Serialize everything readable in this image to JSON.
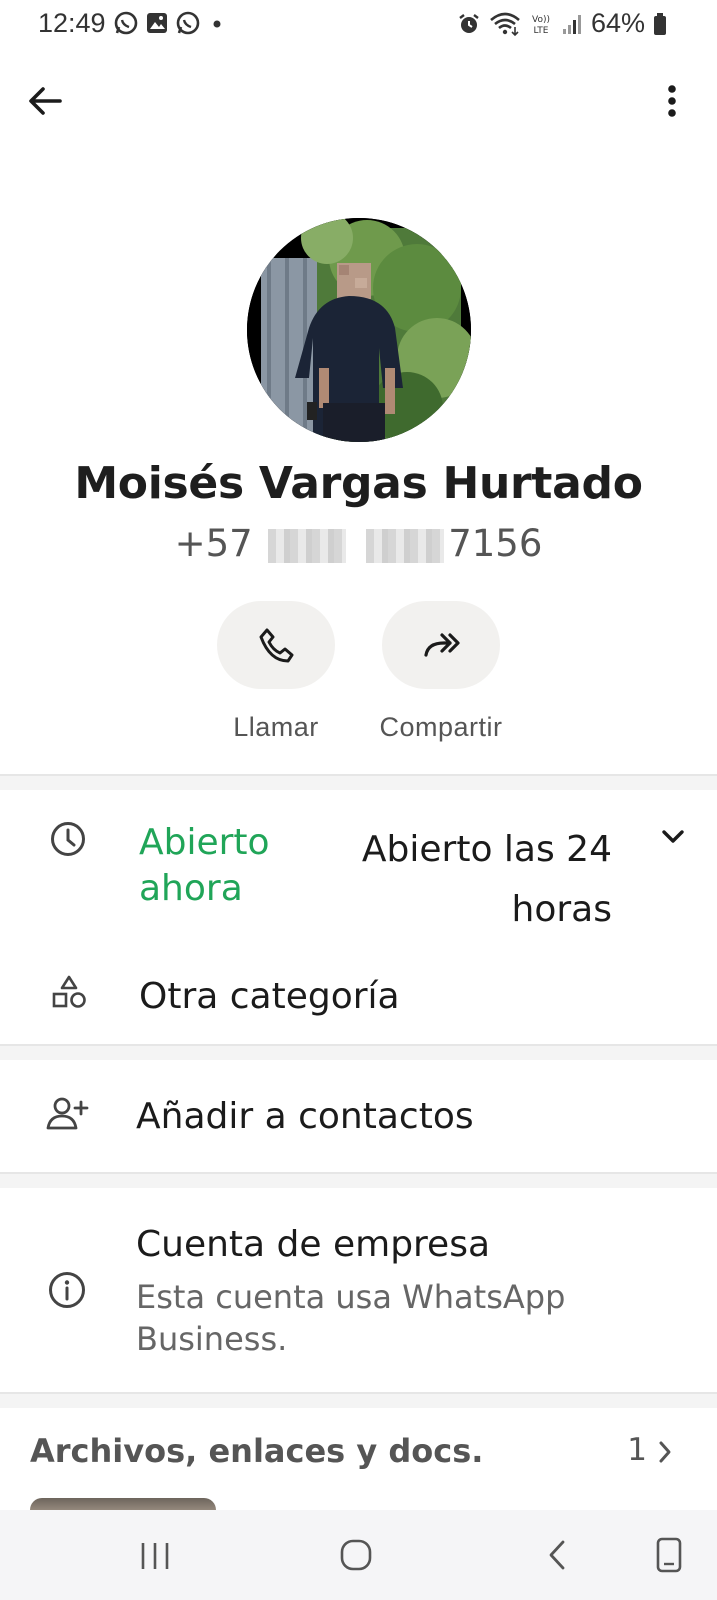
{
  "status_bar": {
    "time": "12:49",
    "battery": "64%",
    "left_icons": [
      "whatsapp-icon",
      "image-icon",
      "whatsapp-icon",
      "dot-icon"
    ],
    "right_icons": [
      "alarm-icon",
      "wifi-icon",
      "volte-icon",
      "signal-icon",
      "battery-icon"
    ],
    "volte_label": "Vo)) LTE"
  },
  "toolbar": {
    "back_icon": "arrow-left-icon",
    "menu_icon": "more-vert-icon"
  },
  "profile": {
    "name": "Moisés Vargas Hurtado",
    "phone_prefix": "+57",
    "phone_suffix": "7156"
  },
  "actions": [
    {
      "label": "Llamar",
      "icon": "phone-icon"
    },
    {
      "label": "Compartir",
      "icon": "share-icon"
    }
  ],
  "business": {
    "hours_status": "Abierto ahora",
    "hours_value": "Abierto las 24 horas",
    "category": "Otra categoría"
  },
  "add_contact": {
    "label": "Añadir a contactos"
  },
  "business_account": {
    "title": "Cuenta de empresa",
    "subtitle": "Esta cuenta usa WhatsApp Business."
  },
  "files": {
    "title": "Archivos, enlaces y docs.",
    "count": "1"
  },
  "colors": {
    "accent_green": "#20a558",
    "action_bg": "#f2f1ef",
    "divider_band": "#f4f4f4"
  }
}
